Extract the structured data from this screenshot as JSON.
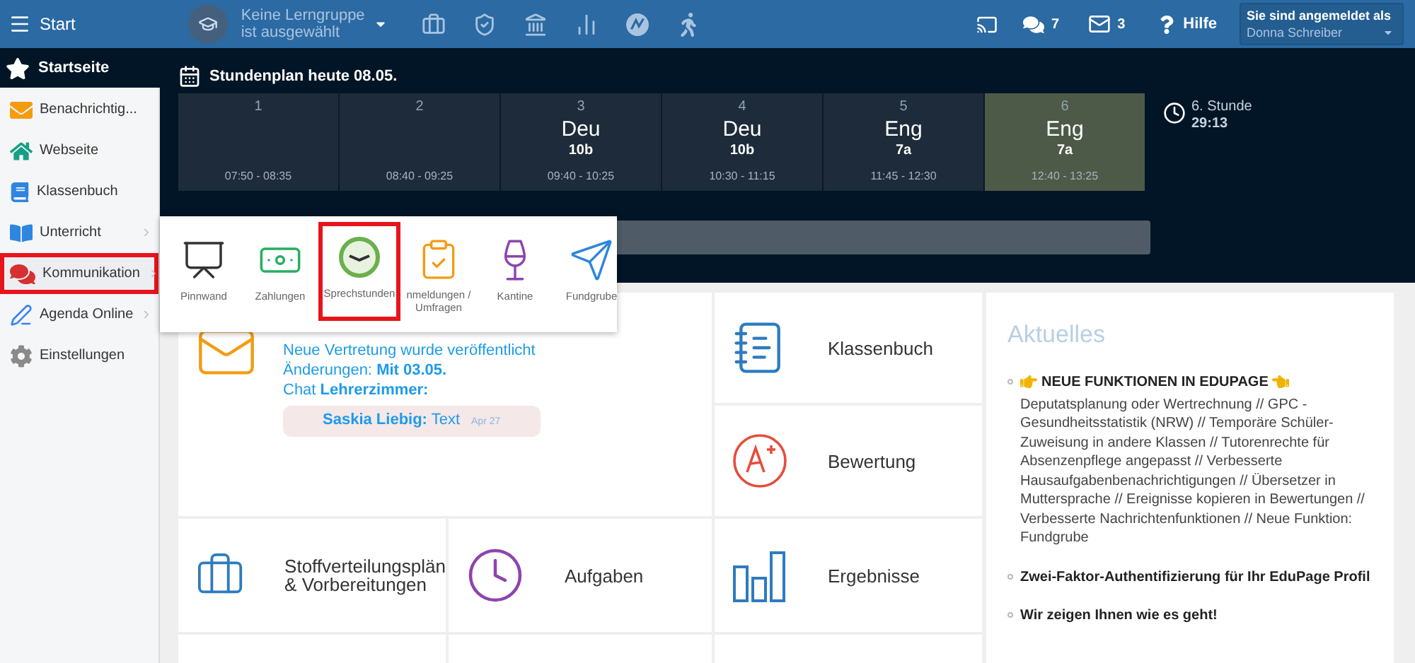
{
  "topbar": {
    "start": "Start",
    "group_line1": "Keine Lerngruppe",
    "group_line2": "ist ausgewählt",
    "chat_count": "7",
    "mail_count": "3",
    "help": "Hilfe",
    "user_label": "Sie sind angemeldet als",
    "user_name": "Donna Schreiber"
  },
  "sidebar": {
    "home": "Startseite",
    "items": [
      {
        "label": "Benachrichtig...",
        "has_submenu": false,
        "highlighted": false
      },
      {
        "label": "Webseite",
        "has_submenu": false,
        "highlighted": false
      },
      {
        "label": "Klassenbuch",
        "has_submenu": false,
        "highlighted": false
      },
      {
        "label": "Unterricht",
        "has_submenu": true,
        "highlighted": false
      },
      {
        "label": "Kommunikation",
        "has_submenu": true,
        "highlighted": true
      },
      {
        "label": "Agenda Online",
        "has_submenu": true,
        "highlighted": false
      },
      {
        "label": "Einstellungen",
        "has_submenu": false,
        "highlighted": false
      }
    ]
  },
  "timetable": {
    "title": "Stundenplan heute 08.05.",
    "lessons": [
      {
        "number": "1",
        "time": "07:50 - 08:35",
        "current": false
      },
      {
        "number": "2",
        "time": "08:40 - 09:25",
        "current": false
      },
      {
        "number": "3",
        "subject": "Deu",
        "class": "10b",
        "time": "09:40 - 10:25",
        "current": false
      },
      {
        "number": "4",
        "subject": "Deu",
        "class": "10b",
        "time": "10:30 - 11:15",
        "current": false
      },
      {
        "number": "5",
        "subject": "Eng",
        "class": "7a",
        "time": "11:45 - 12:30",
        "current": false
      },
      {
        "number": "6",
        "subject": "Eng",
        "class": "7a",
        "time": "12:40 - 13:25",
        "current": true
      }
    ],
    "period": "6. Stunde",
    "remaining": "29:13"
  },
  "submenu": [
    {
      "label": "Pinnwand",
      "highlighted": false
    },
    {
      "label": "Zahlungen",
      "highlighted": false
    },
    {
      "label": "Sprechstunden",
      "highlighted": true
    },
    {
      "label": "nmeldungen / Umfragen",
      "highlighted": false
    },
    {
      "label": "Kantine",
      "highlighted": false
    },
    {
      "label": "Fundgrube",
      "highlighted": false
    }
  ],
  "messages": {
    "lines": [
      "Neue Vertretung wurde veröffentlicht",
      "Änderungen: **Mit 03.05.**",
      "Chat **Lehrerzimmer:**"
    ],
    "chat": {
      "text": "**Saskia Liebig:** Text",
      "time": "Apr 27"
    }
  },
  "tiles": [
    {
      "lines": [
        "Klassenbuch"
      ]
    },
    {
      "lines": [
        "Bewertung"
      ]
    },
    {
      "lines": [
        "Stoffverteilungsplän",
        "& Vorbereitungen"
      ]
    },
    {
      "lines": [
        "Aufgaben"
      ]
    },
    {
      "lines": [
        "Ergebnisse"
      ]
    }
  ],
  "news": {
    "title": "Aktuelles",
    "items": [
      {
        "title": "NEUE FUNKTIONEN IN EDUPAGE",
        "pointers": true,
        "body": "Deputatsplanung oder Wertrechnung // GPC - Gesundheitsstatistik (NRW) // Temporäre Schüler-Zuweisung in andere Klassen // Tutorenrechte für Absenzenpflege angepasst // Verbesserte Hausaufgabenbenachrichtigungen // Übersetzer in Muttersprache // Ereignisse kopieren in Bewertungen //  Verbesserte Nachrichtenfunktionen // Neue Funktion: Fundgrube"
      },
      {
        "title": "Zwei-Faktor-Authentifizierung für Ihr EduPage Profil",
        "pointers": false
      },
      {
        "title": "Wir zeigen Ihnen wie es geht!",
        "pointers": false
      }
    ]
  }
}
